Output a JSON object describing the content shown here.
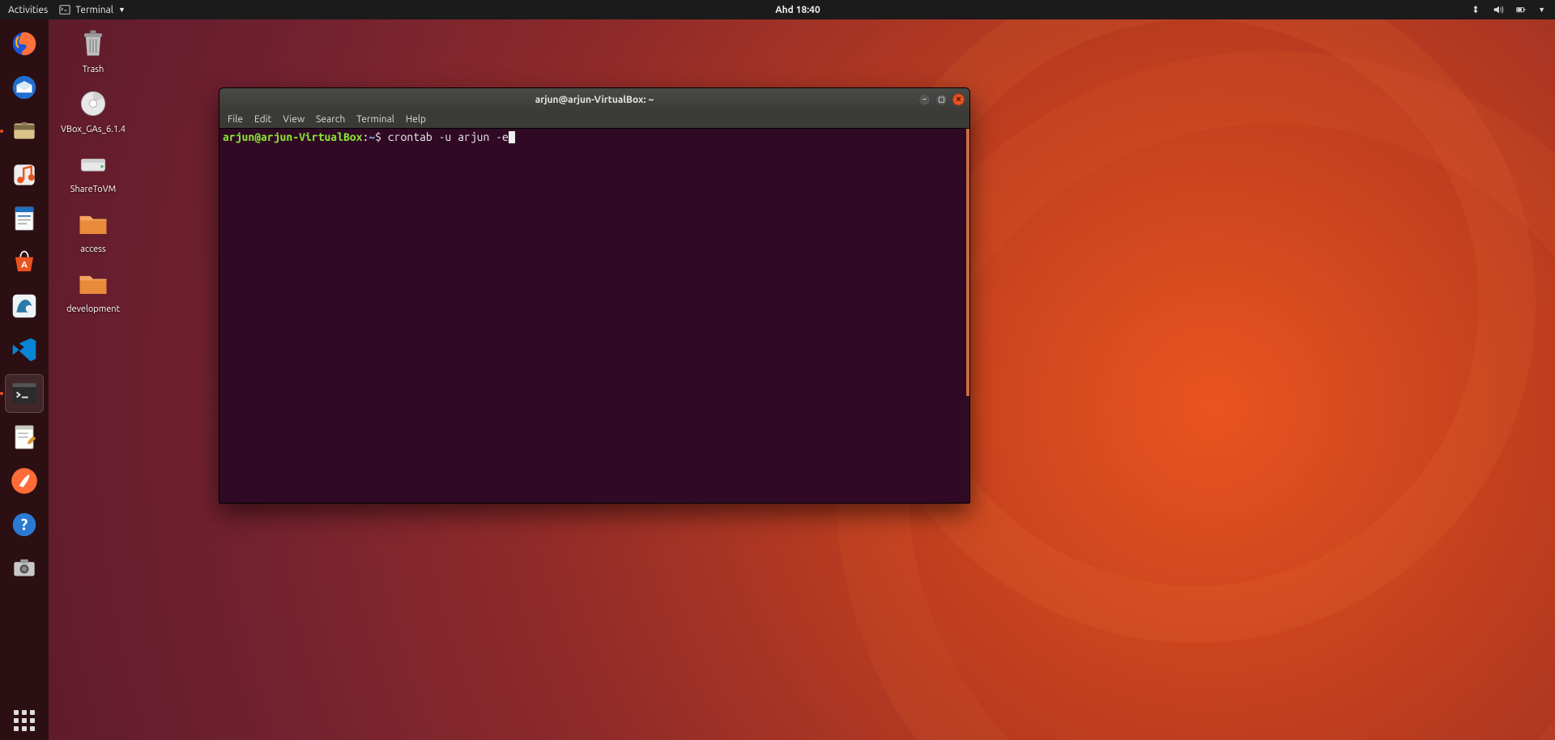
{
  "topbar": {
    "activities": "Activities",
    "app_name": "Terminal",
    "clock": "Ahd 18:40"
  },
  "desktop": {
    "icons": [
      {
        "name": "trash",
        "label": "Trash"
      },
      {
        "name": "vbox-ga",
        "label": "VBox_GAs_6.1.4"
      },
      {
        "name": "share-to-vm",
        "label": "ShareToVM"
      },
      {
        "name": "access",
        "label": "access"
      },
      {
        "name": "development",
        "label": "development"
      }
    ]
  },
  "dock": {
    "items": [
      {
        "name": "firefox"
      },
      {
        "name": "thunderbird"
      },
      {
        "name": "files"
      },
      {
        "name": "rhythmbox"
      },
      {
        "name": "libreoffice-writer"
      },
      {
        "name": "ubuntu-software"
      },
      {
        "name": "mysql-workbench"
      },
      {
        "name": "vscode"
      },
      {
        "name": "terminal"
      },
      {
        "name": "text-editor"
      },
      {
        "name": "postman"
      },
      {
        "name": "help"
      },
      {
        "name": "screenshot"
      }
    ]
  },
  "terminal": {
    "title": "arjun@arjun-VirtualBox: ~",
    "menu": [
      "File",
      "Edit",
      "View",
      "Search",
      "Terminal",
      "Help"
    ],
    "prompt_user": "arjun@arjun-VirtualBox",
    "prompt_sep": ":",
    "prompt_path": "~",
    "prompt_char": "$",
    "command": "crontab -u arjun -e"
  },
  "window_controls": {
    "min": "–",
    "max": "▢",
    "close": "✕"
  }
}
